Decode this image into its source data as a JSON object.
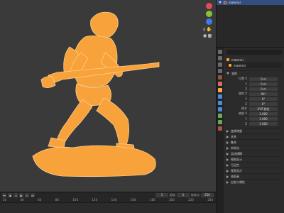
{
  "outliner": {
    "object_name": "material"
  },
  "properties": {
    "object_name": "material",
    "field_name": "material",
    "transform": {
      "label": "变换",
      "rows": [
        {
          "label": "位置 X",
          "value": "0 m"
        },
        {
          "label": "Y",
          "value": "0 m"
        },
        {
          "label": "Z",
          "value": "0 m"
        },
        {
          "label": "旋转 X",
          "value": "90°"
        },
        {
          "label": "Y",
          "value": "0°"
        },
        {
          "label": "Z",
          "value": "0°"
        },
        {
          "label": "模式",
          "value": "XYZ 欧拉"
        },
        {
          "label": "缩放 X",
          "value": "1.000"
        },
        {
          "label": "Y",
          "value": "1.000"
        },
        {
          "label": "Z",
          "value": "1.000"
        }
      ]
    },
    "sections": [
      "变换增量",
      "关系",
      "集合",
      "实例化",
      "运动模糊",
      "视图显示",
      "可见性",
      "视图显示",
      "线条画",
      "自定义属性"
    ]
  },
  "timeline": {
    "frame_current": "1",
    "start_label": "起始",
    "start": "1",
    "end_label": "结束点",
    "end": "250",
    "ruler": [
      "20",
      "40",
      "60",
      "80",
      "100",
      "120",
      "140",
      "160",
      "180",
      "200",
      "220",
      "240"
    ]
  },
  "colors": {
    "wire": "#ff9d2e",
    "accent": "#334d80"
  }
}
